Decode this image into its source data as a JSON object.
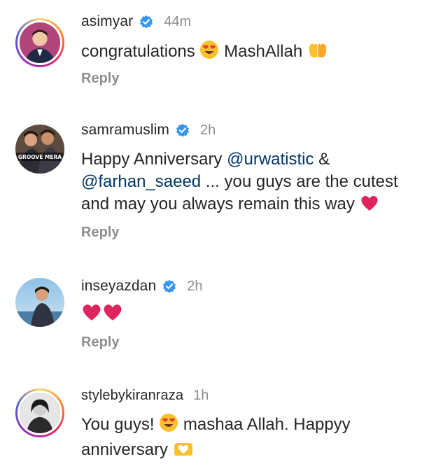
{
  "comments": [
    {
      "username": "asimyar",
      "verified": true,
      "time": "44m",
      "text_a": "congratulations",
      "text_b": "MashAllah",
      "reply": "Reply",
      "avatar_icon": "profile-photo"
    },
    {
      "username": "samramuslim",
      "verified": true,
      "time": "2h",
      "line1_a": "Happy Anniversary ",
      "mention1": "@urwatistic",
      "line1_b": " &",
      "mention2": "@farhan_saeed",
      "line2_b": " ... you guys are the cutest",
      "line3": "and may you always remain this way",
      "avatar_caption": "GROOVE MERA",
      "reply": "Reply"
    },
    {
      "username": "inseyazdan",
      "verified": true,
      "time": "2h",
      "reply": "Reply",
      "avatar_icon": "profile-photo"
    },
    {
      "username": "stylebykiranraza",
      "verified": false,
      "time": "1h",
      "text_a": "You guys!",
      "text_b": "mashaa Allah. Happyy",
      "line2": "anniversary",
      "avatar_icon": "profile-photo"
    }
  ],
  "colors": {
    "verified_blue": "#3897f0",
    "meta_gray": "#8e8e8e",
    "heart_red": "#e0245e",
    "mention_blue": "#00376b"
  }
}
